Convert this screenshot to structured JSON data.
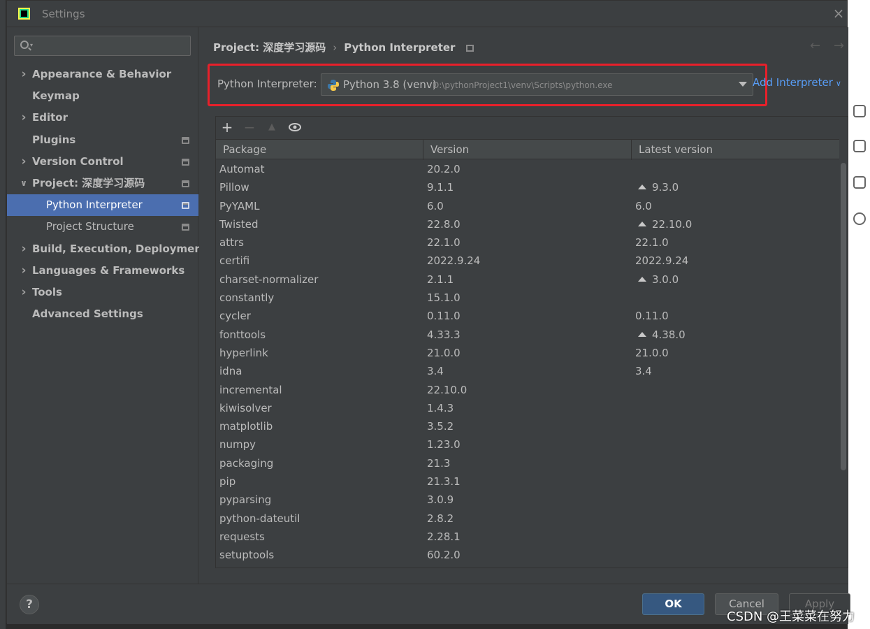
{
  "window": {
    "title": "Settings"
  },
  "search": {
    "placeholder": ""
  },
  "sidebar": {
    "items": [
      {
        "label": "Appearance & Behavior",
        "expandable": true,
        "badge": false
      },
      {
        "label": "Keymap",
        "expandable": false,
        "badge": false
      },
      {
        "label": "Editor",
        "expandable": true,
        "badge": false
      },
      {
        "label": "Plugins",
        "expandable": false,
        "badge": true
      },
      {
        "label": "Version Control",
        "expandable": true,
        "badge": true
      },
      {
        "label": "Project: 深度学习源码",
        "expandable": true,
        "expanded": true,
        "badge": true
      },
      {
        "label": "Python Interpreter",
        "child": true,
        "selected": true,
        "badge": true
      },
      {
        "label": "Project Structure",
        "child": true,
        "badge": true
      },
      {
        "label": "Build, Execution, Deployment",
        "expandable": true,
        "badge": false
      },
      {
        "label": "Languages & Frameworks",
        "expandable": true,
        "badge": false
      },
      {
        "label": "Tools",
        "expandable": true,
        "badge": false
      },
      {
        "label": "Advanced Settings",
        "expandable": false,
        "badge": false
      }
    ]
  },
  "breadcrumb": {
    "project": "Project: 深度学习源码",
    "sep": "›",
    "page": "Python Interpreter"
  },
  "interpreter": {
    "label": "Python Interpreter:",
    "name": "Python 3.8 (venv)",
    "path": "D:\\pythonProject1\\venv\\Scripts\\python.exe",
    "add_label": "Add Interpreter"
  },
  "toolbar": {
    "add": "+",
    "remove": "−",
    "upgrade": "▲",
    "show": "👁"
  },
  "table": {
    "columns": [
      "Package",
      "Version",
      "Latest version"
    ],
    "rows": [
      {
        "name": "Automat",
        "version": "20.2.0",
        "latest": "",
        "upgrade": false
      },
      {
        "name": "Pillow",
        "version": "9.1.1",
        "latest": "9.3.0",
        "upgrade": true
      },
      {
        "name": "PyYAML",
        "version": "6.0",
        "latest": "6.0",
        "upgrade": false
      },
      {
        "name": "Twisted",
        "version": "22.8.0",
        "latest": "22.10.0",
        "upgrade": true
      },
      {
        "name": "attrs",
        "version": "22.1.0",
        "latest": "22.1.0",
        "upgrade": false
      },
      {
        "name": "certifi",
        "version": "2022.9.24",
        "latest": "2022.9.24",
        "upgrade": false
      },
      {
        "name": "charset-normalizer",
        "version": "2.1.1",
        "latest": "3.0.0",
        "upgrade": true
      },
      {
        "name": "constantly",
        "version": "15.1.0",
        "latest": "",
        "upgrade": false
      },
      {
        "name": "cycler",
        "version": "0.11.0",
        "latest": "0.11.0",
        "upgrade": false
      },
      {
        "name": "fonttools",
        "version": "4.33.3",
        "latest": "4.38.0",
        "upgrade": true
      },
      {
        "name": "hyperlink",
        "version": "21.0.0",
        "latest": "21.0.0",
        "upgrade": false
      },
      {
        "name": "idna",
        "version": "3.4",
        "latest": "3.4",
        "upgrade": false
      },
      {
        "name": "incremental",
        "version": "22.10.0",
        "latest": "",
        "upgrade": false
      },
      {
        "name": "kiwisolver",
        "version": "1.4.3",
        "latest": "",
        "upgrade": false
      },
      {
        "name": "matplotlib",
        "version": "3.5.2",
        "latest": "",
        "upgrade": false
      },
      {
        "name": "numpy",
        "version": "1.23.0",
        "latest": "",
        "upgrade": false
      },
      {
        "name": "packaging",
        "version": "21.3",
        "latest": "",
        "upgrade": false
      },
      {
        "name": "pip",
        "version": "21.3.1",
        "latest": "",
        "upgrade": false
      },
      {
        "name": "pyparsing",
        "version": "3.0.9",
        "latest": "",
        "upgrade": false
      },
      {
        "name": "python-dateutil",
        "version": "2.8.2",
        "latest": "",
        "upgrade": false
      },
      {
        "name": "requests",
        "version": "2.28.1",
        "latest": "",
        "upgrade": false
      },
      {
        "name": "setuptools",
        "version": "60.2.0",
        "latest": "",
        "upgrade": false
      }
    ]
  },
  "footer": {
    "help": "?",
    "ok": "OK",
    "cancel": "Cancel",
    "apply": "Apply"
  },
  "watermark": "CSDN @王菜菜在努力",
  "colors": {
    "accent": "#4b6eaf",
    "highlight_border": "#e8202a",
    "link": "#589df6",
    "ok_button": "#365880"
  }
}
